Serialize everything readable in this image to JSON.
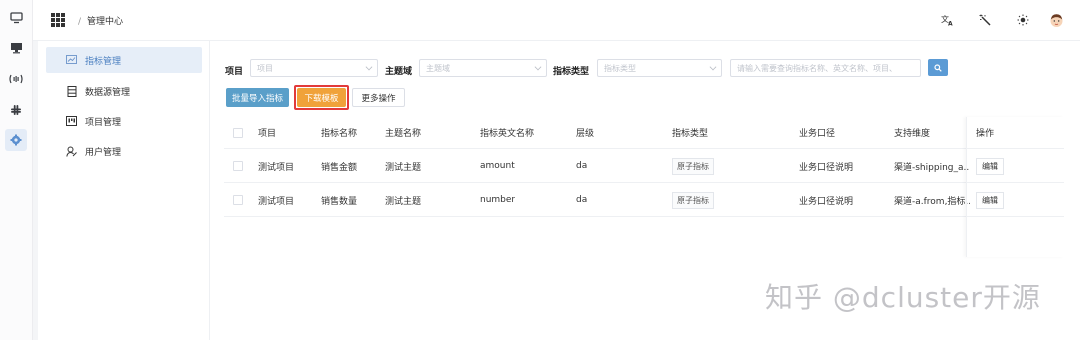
{
  "breadcrumb": {
    "separator": "/",
    "current": "管理中心"
  },
  "rail": {
    "icons": [
      "monitor-icon",
      "desktop-icon",
      "broadcast-icon",
      "slack-icon",
      "settings-icon"
    ]
  },
  "sidebar": {
    "items": [
      {
        "label": "指标管理",
        "icon": "chart-icon",
        "active": true
      },
      {
        "label": "数据源管理",
        "icon": "database-icon",
        "active": false
      },
      {
        "label": "项目管理",
        "icon": "project-icon",
        "active": false
      },
      {
        "label": "用户管理",
        "icon": "user-icon",
        "active": false
      }
    ]
  },
  "filters": {
    "project_label": "项目",
    "project_placeholder": "项目",
    "domain_label": "主题域",
    "domain_placeholder": "主题域",
    "type_label": "指标类型",
    "type_placeholder": "指标类型",
    "search_placeholder": "请输入需要查询指标名称、英文名称、项目、"
  },
  "actions": {
    "batch_import": "批量导入指标",
    "download_template": "下载模板",
    "more": "更多操作"
  },
  "table": {
    "columns": [
      "项目",
      "指标名称",
      "主题名称",
      "指标英文名称",
      "层级",
      "指标类型",
      "业务口径",
      "支持维度",
      "操作"
    ],
    "rows": [
      {
        "project": "测试项目",
        "name": "销售金额",
        "topic": "测试主题",
        "en_name": "amount",
        "level": "da",
        "type": "原子指标",
        "caliber": "业务口径说明",
        "dims": "渠道-shipping_a...",
        "op": "编辑"
      },
      {
        "project": "测试项目",
        "name": "销售数量",
        "topic": "测试主题",
        "en_name": "number",
        "level": "da",
        "type": "原子指标",
        "caliber": "业务口径说明",
        "dims": "渠道-a.from,指标...",
        "op": "编辑"
      }
    ]
  },
  "watermark": "知乎 @dcluster开源",
  "colors": {
    "accent": "#5b9bd5",
    "orange": "#f0a23a",
    "highlight": "#e23a3a"
  }
}
